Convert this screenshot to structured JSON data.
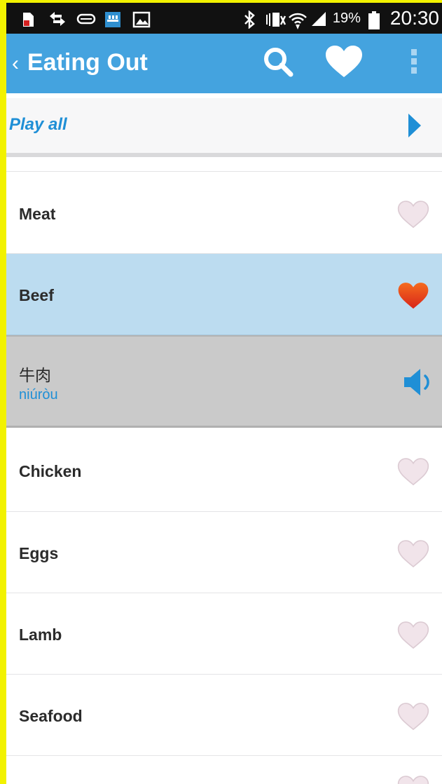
{
  "status_bar": {
    "battery_percent": "19%",
    "time": "20:30",
    "icons": [
      "sim-card-icon",
      "data-transfer-icon",
      "usb-icon",
      "rtl-app-icon",
      "image-icon",
      "bluetooth-icon",
      "vibrate-icon",
      "wifi-icon",
      "signal-icon",
      "battery-icon"
    ]
  },
  "app_bar": {
    "back_glyph": "‹",
    "title": "Eating Out",
    "actions": [
      "search-icon",
      "heart-icon",
      "overflow-menu-icon"
    ]
  },
  "play_all": {
    "label": "Play all"
  },
  "list": {
    "items": [
      {
        "label": "Meat",
        "favorited": false
      },
      {
        "label": "Beef",
        "favorited": true,
        "selected": true
      },
      {
        "label": "Chicken",
        "favorited": false
      },
      {
        "label": "Eggs",
        "favorited": false
      },
      {
        "label": "Lamb",
        "favorited": false
      },
      {
        "label": "Seafood",
        "favorited": false
      }
    ],
    "expanded": {
      "hanzi": "牛肉",
      "pinyin": "niúròu"
    }
  },
  "colors": {
    "app_bar": "#44a3df",
    "accent_text": "#1f8fd6",
    "selected_row": "#bcdcf0",
    "detail_bg": "#cacaca",
    "heart_inactive": "#eadde3",
    "heart_active": "#e8461c"
  }
}
